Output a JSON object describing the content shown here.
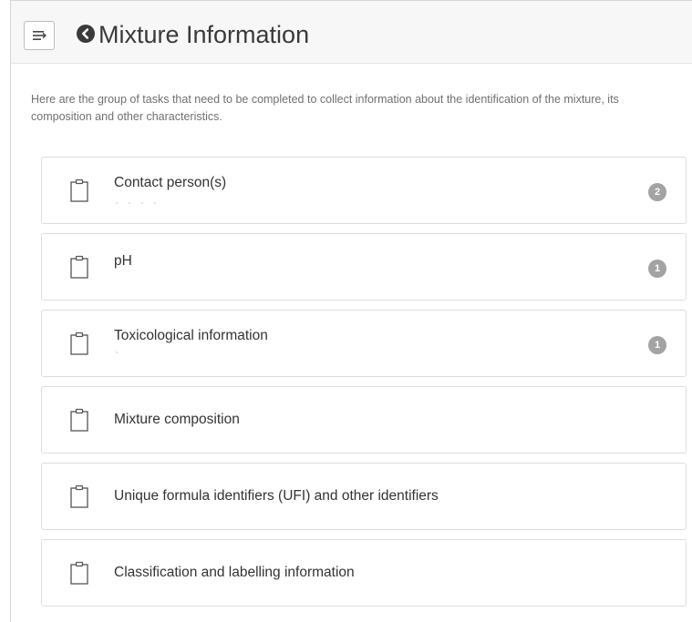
{
  "header": {
    "title": "Mixture Information",
    "menu_icon": "menu-icon",
    "back_icon": "back-circle-icon"
  },
  "intro": {
    "text": "Here are the group of tasks that need to be completed to collect information about the identification of the mixture, its composition and other characteristics."
  },
  "tasks": [
    {
      "label": "Contact person(s)",
      "badge": "2",
      "icon": "clipboard-icon"
    },
    {
      "label": "pH",
      "badge": "1",
      "icon": "clipboard-icon"
    },
    {
      "label": "Toxicological information",
      "badge": "1",
      "icon": "clipboard-icon"
    },
    {
      "label": "Mixture composition",
      "badge": null,
      "icon": "clipboard-icon"
    },
    {
      "label": "Unique formula identifiers (UFI) and other identifiers",
      "badge": null,
      "icon": "clipboard-icon"
    },
    {
      "label": "Classification and labelling information",
      "badge": null,
      "icon": "clipboard-icon"
    }
  ],
  "colors": {
    "badge": "#a3a3a3",
    "header_bg": "#f7f7f7",
    "card_border": "#dddddd"
  }
}
